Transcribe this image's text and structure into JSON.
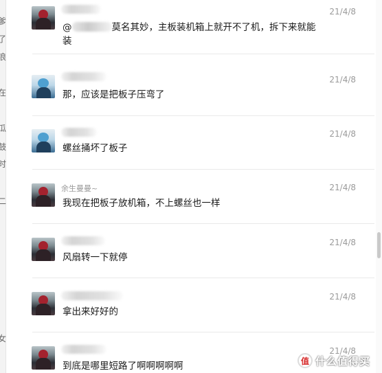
{
  "messages": [
    {
      "time": "21/4/8",
      "avatar": "avatar-dark",
      "name_label": "",
      "mention_prefix": "@",
      "mention_suffix": "莫名其妙，主板装机箱上就开不了机，拆下来就能装",
      "text": ""
    },
    {
      "time": "21/4/8",
      "avatar": "avatar-blue",
      "name_label": "",
      "text": "那，应该是把板子压弯了"
    },
    {
      "time": "21/4/8",
      "avatar": "avatar-blue",
      "name_label": "",
      "text": "螺丝捅坏了板子"
    },
    {
      "time": "21/4/8",
      "avatar": "avatar-dark",
      "name_label": "余生曼曼~",
      "text": "我现在把板子放机箱，不上螺丝也一样"
    },
    {
      "time": "21/4/8",
      "avatar": "avatar-dark",
      "name_label": "",
      "text": "风扇转一下就停"
    },
    {
      "time": "21/4/8",
      "avatar": "avatar-dark",
      "name_label": "",
      "text": "拿出来好好的"
    },
    {
      "time": "21/4/8",
      "avatar": "avatar-dark",
      "name_label": "",
      "text": "到底是哪里短路了啊啊啊啊啊"
    }
  ],
  "left_edge_fragments": [
    "爹",
    "了",
    "浪",
    "在",
    "瓜",
    "鼓",
    "时",
    "二",
    "女"
  ],
  "watermark": {
    "logo": "值",
    "text": "什么值得买"
  },
  "colors": {
    "timestamp": "#9a9a9a",
    "text": "#1a1a1a",
    "divider": "#e9e9e9",
    "scroll_thumb": "#c9c9c9"
  }
}
